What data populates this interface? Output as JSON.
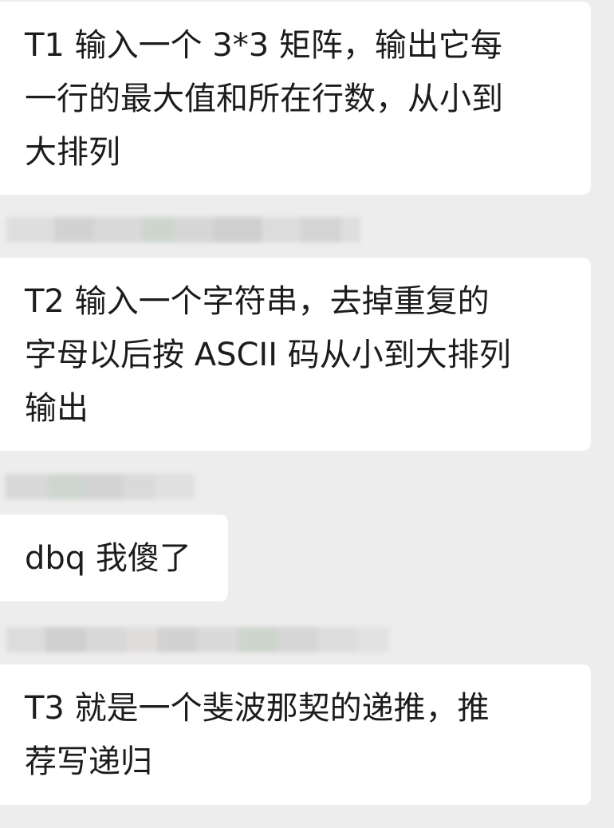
{
  "messages": [
    {
      "text": "T1 输入一个 3*3 矩阵，输出它每\n一行的最大值和所在行数，从小到\n大排列"
    },
    {
      "text": "T2 输入一个字符串，去掉重复的\n字母以后按 ASCII 码从小到大排列\n输出"
    },
    {
      "text": "dbq 我傻了"
    },
    {
      "text": "T3 就是一个斐波那契的递推，推\n荐写递归"
    }
  ],
  "colors": {
    "background": "#ededed",
    "bubble": "#ffffff",
    "text": "#1c1c1c",
    "blur_tones": [
      "#d4d4d4",
      "#c9c9c9",
      "#dcdcdc",
      "#d0d8d0",
      "#e2dede"
    ]
  }
}
